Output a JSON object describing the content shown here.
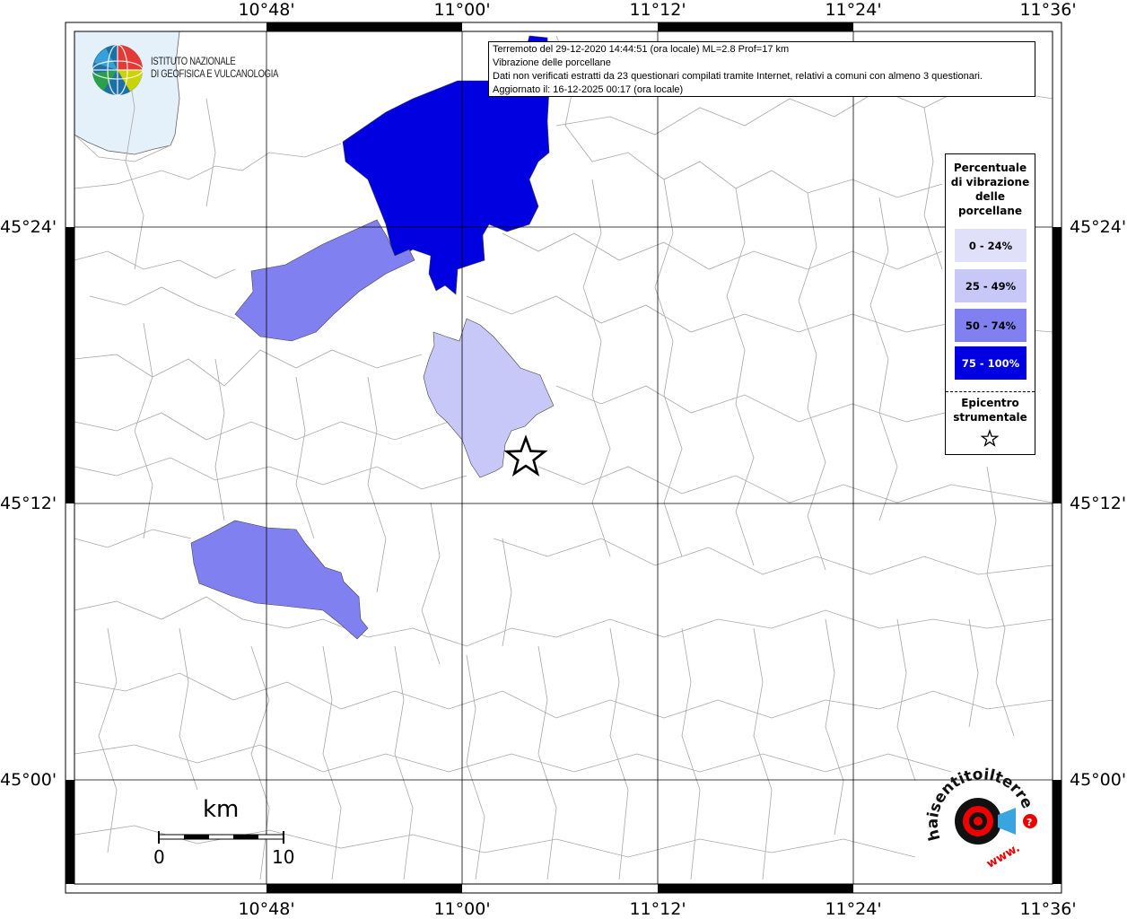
{
  "header": {
    "line1": "Terremoto del 29-12-2020 14:44:51 (ora locale) ML=2.8 Prof=17 km",
    "line2": "Vibrazione delle porcellane",
    "line3": "Dati non verificati estratti da 23 questionari compilati tramite Internet, relativi a comuni con almeno 3 questionari.",
    "line4": "Aggiornato il: 16-12-2025 00:17 (ora locale)"
  },
  "logo": {
    "line1": "ISTITUTO NAZIONALE",
    "line2": "DI GEOFISICA E VULCANOLOGIA"
  },
  "axes": {
    "top": [
      "10°48'",
      "11°00'",
      "11°12'",
      "11°24'",
      "11°36'"
    ],
    "bottom": [
      "10°48'",
      "11°00'",
      "11°12'",
      "11°24'",
      "11°36'"
    ],
    "left": [
      "45°24'",
      "45°12'",
      "45°00'"
    ],
    "right": [
      "45°24'",
      "45°12'",
      "45°00'"
    ]
  },
  "legend": {
    "title_lines": [
      "Percentuale",
      "di vibrazione",
      "delle",
      "porcellane"
    ],
    "items": [
      {
        "label": "0 - 24%",
        "color": "#e0e0fa",
        "text_color": "#000000"
      },
      {
        "label": "25 - 49%",
        "color": "#c8c8f8",
        "text_color": "#000000"
      },
      {
        "label": "50 - 74%",
        "color": "#8080f0",
        "text_color": "#000000"
      },
      {
        "label": "75 - 100%",
        "color": "#0000e0",
        "text_color": "#ffffff"
      }
    ],
    "epicenter_lines": [
      "Epicentro",
      "strumentale"
    ]
  },
  "scale": {
    "unit": "km",
    "min_label": "0",
    "max_label": "10"
  },
  "watermark": {
    "text": "haisentitoilterremoto.it",
    "www": "www."
  }
}
